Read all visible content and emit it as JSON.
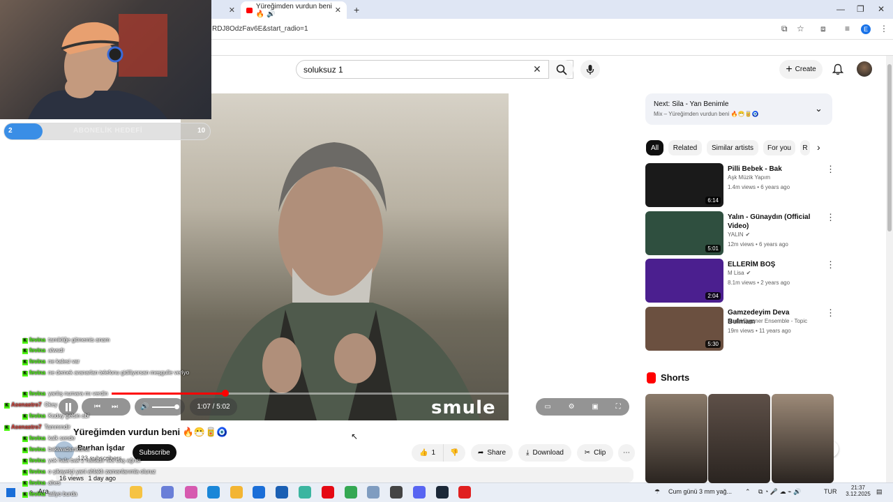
{
  "browser": {
    "tabs": [
      {
        "label": ""
      },
      {
        "label": "Yüreğimden vurdun beni 🔥 🔊"
      }
    ],
    "new_tab": "+",
    "url": "RDJ8OdzFav6E&start_radio=1",
    "window_controls": [
      "—",
      "❐",
      "✕"
    ],
    "profile_initial": "E"
  },
  "youtube": {
    "search": {
      "value": "soluksuz 1"
    },
    "create_label": "Create"
  },
  "player": {
    "time_current": "1:07",
    "time_total": "5:02",
    "time_display": "1:07 / 5:02",
    "progress_fraction": 0.22,
    "watermark": "smule"
  },
  "stream_overlay": {
    "goal_label": "ABONELİK HEDEFİ",
    "goal_current": "2",
    "goal_target": "10",
    "chat": [
      {
        "user": "fevina",
        "text": "tamikliğe gitmemis anam"
      },
      {
        "user": "fevina",
        "text": "alwsdr"
      },
      {
        "user": "fevina",
        "text": "ne kalesi var"
      },
      {
        "user": "fevina",
        "text": "ne demek aranarlan telefonu gidiliyorsan meşgulle veriyo"
      },
      {
        "user": "fevina",
        "text": "yanlış numara mı verdin"
      },
      {
        "user": "Asenastro7",
        "text": "Okey"
      },
      {
        "user": "fevina",
        "text": "Kaday gelsin abi"
      },
      {
        "user": "Asenastro7",
        "text": "Tammmdir"
      },
      {
        "user": "fevina",
        "text": "kalk sende"
      },
      {
        "user": "fevina",
        "text": "bakiwadsmkdfsa"
      },
      {
        "user": "fevina",
        "text": "yok hala bak 2 haftadır fiks baş ağrısı"
      },
      {
        "user": "fevina",
        "text": "o şikayetçi yani ahlaklı zamanlarımla oluruz"
      },
      {
        "user": "fevina",
        "text": "ahes"
      },
      {
        "user": "fevina",
        "text": "taliyo burda"
      }
    ]
  },
  "video": {
    "title": "Yüreğimden vurdun beni 🔥😷🥫🧿",
    "channel": "Burhan İşdar",
    "subscribers": "123 subscribers",
    "subscribe_label": "Subscribe",
    "likes": "1",
    "share_label": "Share",
    "download_label": "Download",
    "clip_label": "Clip",
    "views": "16 views",
    "age": "1 day ago"
  },
  "sidebar": {
    "next_title": "Next: Sila - Yan Benimle",
    "next_subtitle": "Mix – Yüreğimden vurdun beni 🔥😷🥫🧿",
    "chips": [
      "All",
      "Related",
      "Similar artists",
      "For you",
      "R"
    ],
    "videos": [
      {
        "title": "Pilli Bebek - Bak",
        "channel": "Aşk Müzik Yapım",
        "meta": "1.4m views • 6 years ago",
        "duration": "6:14",
        "verified": false
      },
      {
        "title": "Yalın - Günaydın (Official Video)",
        "channel": "YALIN",
        "meta": "12m views • 6 years ago",
        "duration": "5:01",
        "verified": true
      },
      {
        "title": "ELLERİM BOŞ",
        "channel": "M Lisa",
        "meta": "8.1m views • 2 years ago",
        "duration": "2:04",
        "verified": true
      },
      {
        "title": "Gamzedeyim Deva Bulmam",
        "channel": "Kudsi Erguner Ensemble - Topic",
        "meta": "19m views • 11 years ago",
        "duration": "5:30",
        "verified": false
      }
    ],
    "thumb_colors": [
      "#1a1a1a",
      "#2f4f3f",
      "#4b1f8f",
      "#6b5040"
    ],
    "shorts_heading": "Shorts",
    "short_colors": [
      "#8a7a6a",
      "#5e5048",
      "#9d8a78"
    ]
  },
  "taskbar": {
    "search_label": "Ara",
    "weather": "Cum günü 3 mm yağ...",
    "language": "TUR",
    "time": "21:37",
    "date": "3.12.2025"
  },
  "colors": {
    "accent": "#ff0000",
    "chat_badge": "#53fc18",
    "goal_fill": "#3a8ee6"
  }
}
